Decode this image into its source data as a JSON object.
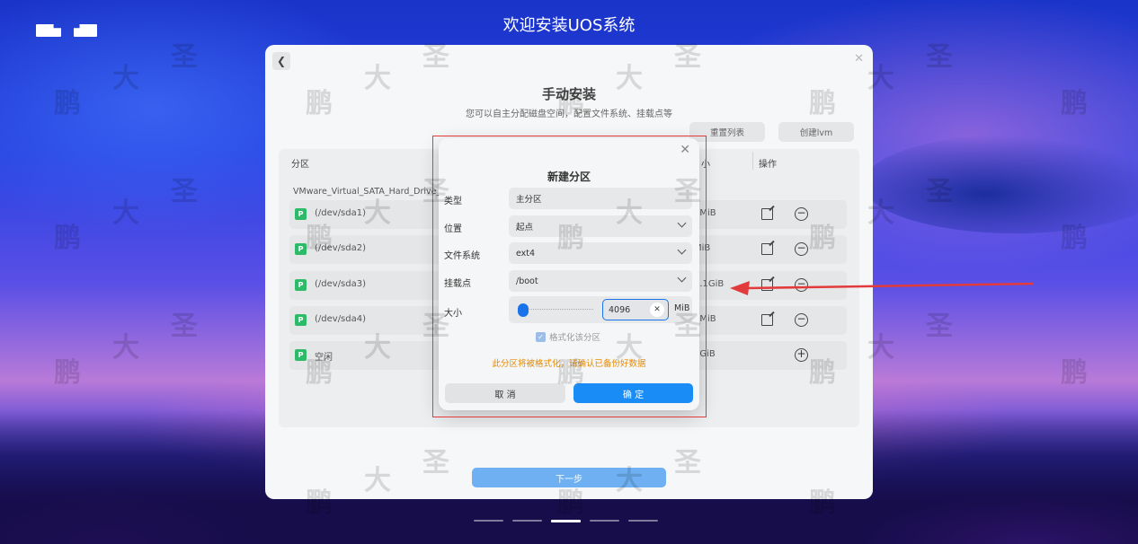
{
  "installer_title": "欢迎安装UOS系统",
  "panel": {
    "title": "手动安装",
    "subtitle": "您可以自主分配磁盘空间，配置文件系统、挂载点等",
    "reset_list_label": "重置列表",
    "create_lvm_label": "创建lvm",
    "next_label": "下一步"
  },
  "table": {
    "headers": {
      "partition": "分区",
      "size_partial": "小",
      "action": "操作"
    },
    "disk_name": "VMware_Virtual_SATA_Hard_Drive_Sa",
    "rows": [
      {
        "badge": "P",
        "name": "(/dev/sda1)",
        "size": "0MiB",
        "action": "minus"
      },
      {
        "badge": "P",
        "name": "(/dev/sda2)",
        "size": "MiB",
        "action": "minus"
      },
      {
        "badge": "P",
        "name": "(/dev/sda3)",
        "size": "0.1GiB",
        "action": "minus"
      },
      {
        "badge": "P",
        "name": "(/dev/sda4)",
        "size": "0MiB",
        "action": "minus"
      },
      {
        "badge": "P",
        "name": "空闲",
        "size": "0GiB",
        "action": "plus"
      }
    ]
  },
  "dialog": {
    "title": "新建分区",
    "type_label": "类型",
    "type_value": "主分区",
    "location_label": "位置",
    "location_value": "起点",
    "fs_label": "文件系统",
    "fs_value": "ext4",
    "mount_label": "挂载点",
    "mount_value": "/boot",
    "size_label": "大小",
    "size_value": "4096",
    "size_unit": "MiB",
    "format_label": "格式化该分区",
    "format_checked": true,
    "warning": "此分区将被格式化，请确认已备份好数据",
    "cancel_label": "取 消",
    "ok_label": "确 定"
  },
  "progress_step": 3,
  "progress_total": 5,
  "colors": {
    "accent": "#1a8cf5",
    "warning": "#e68a00",
    "highlight": "#e23b3b",
    "badge": "#2dbb6a"
  }
}
